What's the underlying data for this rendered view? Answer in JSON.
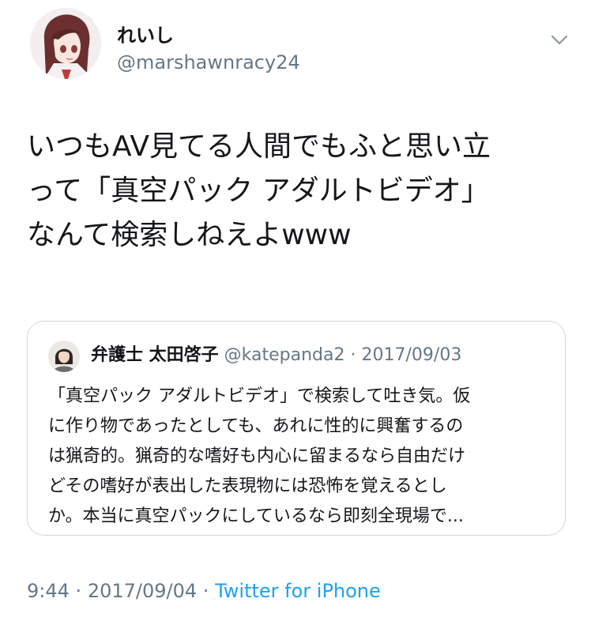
{
  "tweet": {
    "author": {
      "display_name": "れいし",
      "handle": "@marshawnracy24"
    },
    "text_lines": [
      "いつもAV見てる人間でもふと思い立",
      "って「真空パック アダルトビデオ」",
      "なんて検索しねえよwww"
    ],
    "quoted": {
      "author_name": "弁護士 太田啓子",
      "handle": "@katepanda2",
      "separator": "·",
      "date": "2017/09/03",
      "text_lines": [
        "「真空パック アダルトビデオ」で検索して吐き気。仮",
        "に作り物であったとしても、あれに性的に興奮するの",
        "は猟奇的。猟奇的な嗜好も内心に留まるなら自由だけ",
        "どその嗜好が表出した表現物には恐怖を覚えるとし",
        "か。本当に真空パックにしているなら即刻全現場で..."
      ]
    },
    "footer": {
      "time": "9:44",
      "sep1": "·",
      "date": "2017/09/04",
      "sep2": "·",
      "source": "Twitter for iPhone"
    }
  },
  "icons": {
    "caret": "chevron-down-icon",
    "avatar": "anime-girl-avatar",
    "quoted_avatar": "portrait-avatar"
  },
  "colors": {
    "text": "#14171a",
    "secondary": "#657786",
    "link": "#1da1f2",
    "border": "#ccd6dd"
  }
}
